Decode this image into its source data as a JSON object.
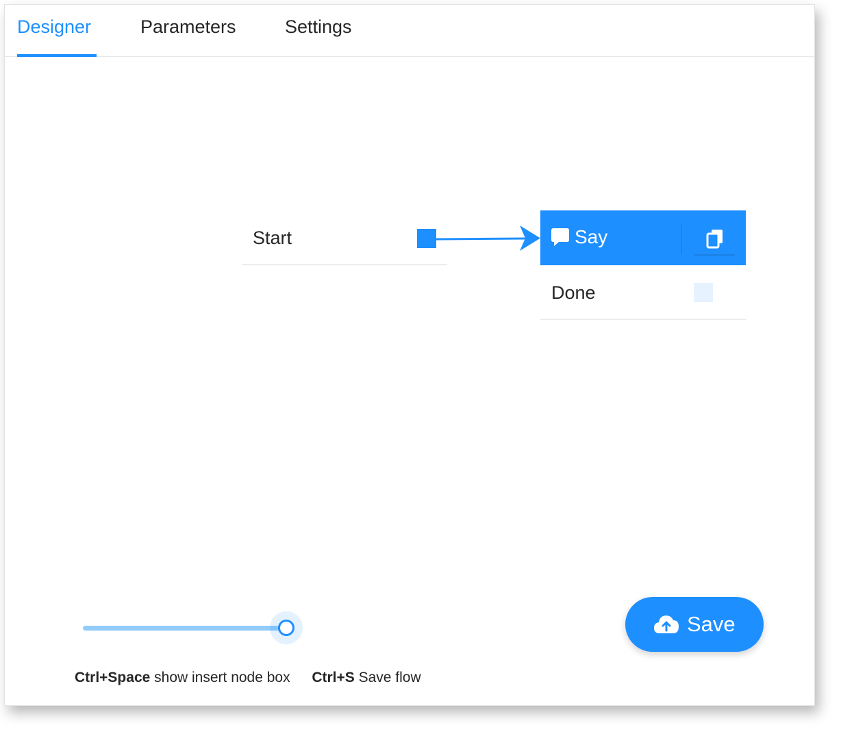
{
  "tabs": [
    {
      "label": "Designer",
      "active": true
    },
    {
      "label": "Parameters",
      "active": false
    },
    {
      "label": "Settings",
      "active": false
    }
  ],
  "flow": {
    "start_node": {
      "label": "Start"
    },
    "say_node": {
      "title": "Say",
      "icon": "speech-bubble-icon",
      "action_icon": "copy-icon",
      "outputs": [
        {
          "label": "Done",
          "connected": false
        }
      ]
    }
  },
  "zoom_slider": {
    "value_fraction": 0.9
  },
  "shortcuts": [
    {
      "keys": "Ctrl+Space",
      "description": "show insert node box"
    },
    {
      "keys": "Ctrl+S",
      "description": "Save flow"
    }
  ],
  "save_button": {
    "label": "Save",
    "icon": "cloud-upload-icon"
  },
  "colors": {
    "accent": "#1e8fff",
    "slider_track": "#91ccfb",
    "empty_port": "#e6f2ff"
  }
}
